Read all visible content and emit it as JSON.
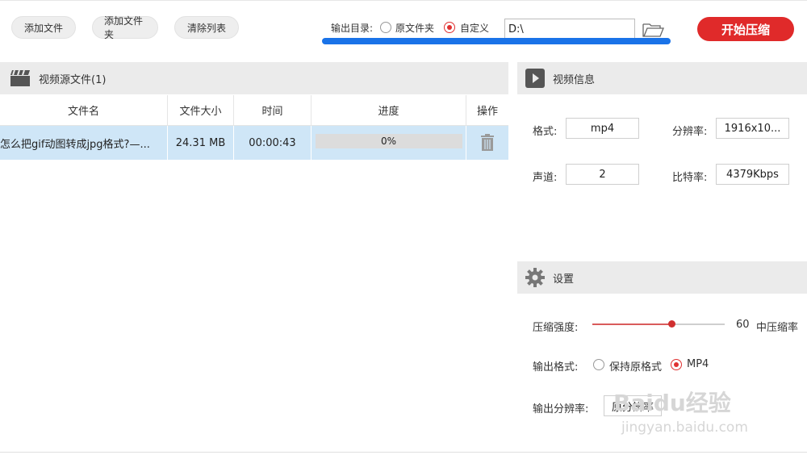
{
  "toolbar": {
    "add_file": "添加文件",
    "add_folder": "添加文件夹",
    "clear_list": "清除列表",
    "output_dir_label": "输出目录:",
    "radio_original": "原文件夹",
    "radio_custom": "自定义",
    "output_path": "D:\\",
    "start_button": "开始压缩"
  },
  "source_panel": {
    "title": "视频源文件(1)",
    "columns": [
      "文件名",
      "文件大小",
      "时间",
      "进度",
      "操作"
    ],
    "rows": [
      {
        "name": "怎么把gif动图转成jpg格式?—...",
        "size": "24.31 MB",
        "time": "00:00:43",
        "progress": "0%"
      }
    ]
  },
  "info_panel": {
    "title": "视频信息",
    "format_label": "格式:",
    "format_value": "mp4",
    "resolution_label": "分辨率:",
    "resolution_value": "1916x10...",
    "channels_label": "声道:",
    "channels_value": "2",
    "bitrate_label": "比特率:",
    "bitrate_value": "4379Kbps"
  },
  "settings_panel": {
    "title": "设置",
    "strength_label": "压缩强度:",
    "strength_value": "60",
    "strength_fraction": 0.6,
    "strength_desc": "中压缩率",
    "format_label": "输出格式:",
    "format_opt1": "保持原格式",
    "format_opt2": "MP4",
    "resolution_label": "输出分辨率:",
    "resolution_value": "原分辨率"
  },
  "watermark": {
    "line1": "Baidu经验",
    "line2": "jingyan.baidu.com"
  },
  "colors": {
    "accent": "#e02a2a",
    "selection": "#cfe6f7",
    "panel_header": "#ebebeb",
    "highlight": "#1a73e8"
  }
}
